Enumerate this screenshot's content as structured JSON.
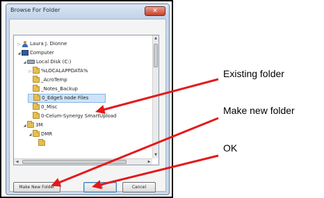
{
  "dialog": {
    "title": "Browse For Folder",
    "close_glyph": "✕",
    "buttons": {
      "make_new_folder": "Make New Folder",
      "ok": "OK",
      "cancel": "Cancel"
    }
  },
  "tree": {
    "items": [
      {
        "label": "Laura J. Dionne",
        "icon": "person-icon",
        "expander": "▷"
      },
      {
        "label": "Computer",
        "icon": "computer-icon",
        "expander": "◢"
      },
      {
        "label": "Local Disk (C:)",
        "icon": "disk-icon",
        "expander": "◢"
      },
      {
        "label": "%LOCALAPPDATA%",
        "icon": "folder-icon",
        "expander": "▷"
      },
      {
        "label": "_AcroTemp",
        "icon": "folder-icon",
        "expander": ""
      },
      {
        "label": "_Notes_Backup",
        "icon": "folder-icon",
        "expander": ""
      },
      {
        "label": "0_EdgeS node Files",
        "icon": "folder-icon",
        "expander": "",
        "selected": true
      },
      {
        "label": "0_Misc",
        "icon": "folder-icon",
        "expander": ""
      },
      {
        "label": "0-Celum-Synergy SmartUpload",
        "icon": "folder-icon",
        "expander": ""
      },
      {
        "label": "3M",
        "icon": "folder-icon",
        "expander": "◢"
      },
      {
        "label": "DMR",
        "icon": "folder-icon",
        "expander": "◢"
      }
    ],
    "scrollbar_glyphs": {
      "up": "▲",
      "down": "▼",
      "left": "◀",
      "right": "▶",
      "grip": "III"
    }
  },
  "callouts": {
    "existing_folder": "Existing folder",
    "make_new_folder": "Make new folder",
    "ok": "OK"
  },
  "colors": {
    "arrow": "#e3191b",
    "selection": "#cde3f8",
    "close_button": "#c4412b"
  }
}
